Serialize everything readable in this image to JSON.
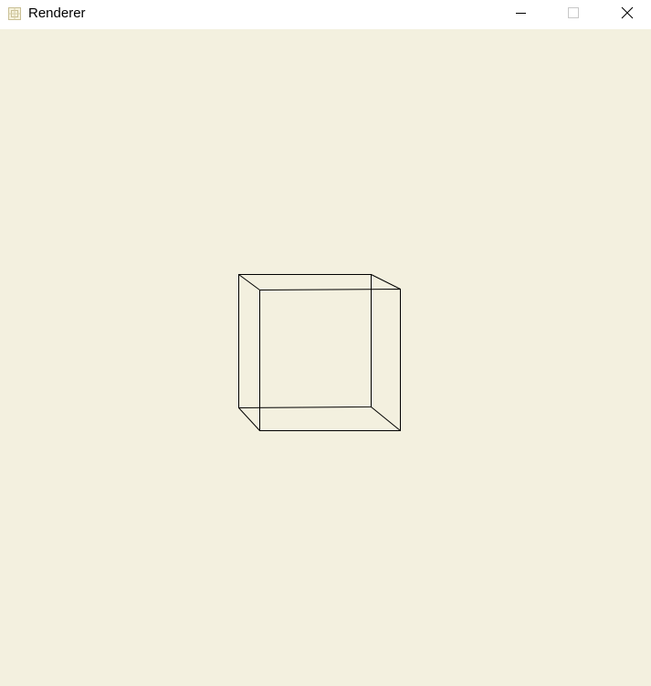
{
  "window": {
    "title": "Renderer",
    "background_color": "#f3f0df",
    "titlebar_color": "#ffffff",
    "icons": {
      "app": "renderer-app-icon",
      "minimize": "minimize-icon",
      "maximize": "maximize-icon",
      "close": "close-icon"
    }
  },
  "scene": {
    "object": "wireframe-cube",
    "line_color": "#000000"
  }
}
